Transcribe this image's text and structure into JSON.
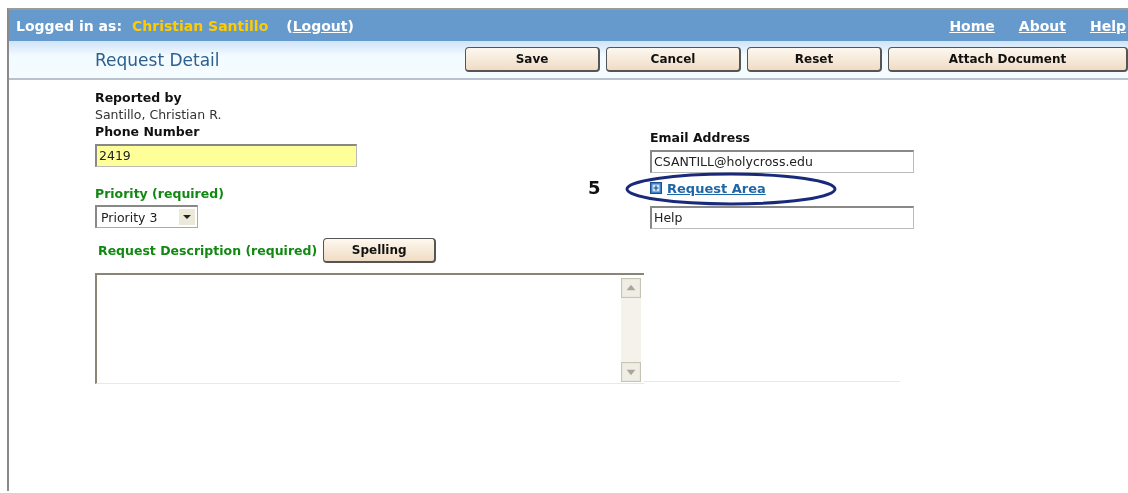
{
  "session": {
    "label": "Logged in as:",
    "user": "Christian Santillo",
    "logout_open": "(",
    "logout": "Logout",
    "logout_close": ")"
  },
  "nav": [
    {
      "label": "Home"
    },
    {
      "label": "About"
    },
    {
      "label": "Help"
    }
  ],
  "page_title": "Request Detail",
  "toolbar": [
    "Save",
    "Cancel",
    "Reset",
    "Attach Document"
  ],
  "reported_by": {
    "label": "Reported by",
    "value": "Santillo, Christian R."
  },
  "phone": {
    "label": "Phone Number",
    "value": "2419"
  },
  "email": {
    "label": "Email Address",
    "value": "CSANTILL@holycross.edu"
  },
  "priority": {
    "label": "Priority (required)",
    "value": "Priority 3"
  },
  "request_area": {
    "label": "Request Area",
    "value": "Help"
  },
  "annotation": {
    "number": "5"
  },
  "description": {
    "label": "Request Description (required)",
    "button": "Spelling"
  }
}
